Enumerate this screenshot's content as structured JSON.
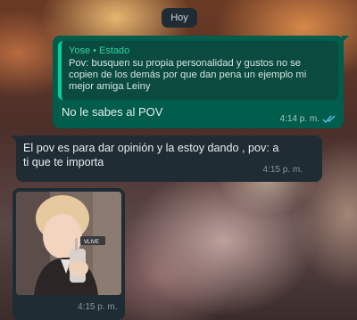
{
  "date_chip": "Hoy",
  "outgoing": {
    "quote": {
      "author": "Yose",
      "separator": "•",
      "source": "Estado",
      "lines": [
        "Pov: busquen su propia personalidad y gustos no se",
        "copien de los demás por que dan pena un ejemplo mi",
        "mejor amiga Leiny"
      ]
    },
    "text": "No le sabes al POV",
    "time": "4:14 p. m.",
    "status_icon": "double-check-read-icon",
    "check_color": "#53bdeb"
  },
  "incoming": {
    "lines": [
      "El pov es para dar opinión y la estoy dando , pov: a",
      "ti que te importa"
    ],
    "time": "4:15 p. m."
  },
  "media": {
    "overlay_label": "VLIVE",
    "time": "4:15 p. m."
  },
  "colors": {
    "outgoing_bubble": "#005c4b",
    "incoming_bubble": "#1f2c34",
    "quote_accent": "#06cf9c"
  }
}
